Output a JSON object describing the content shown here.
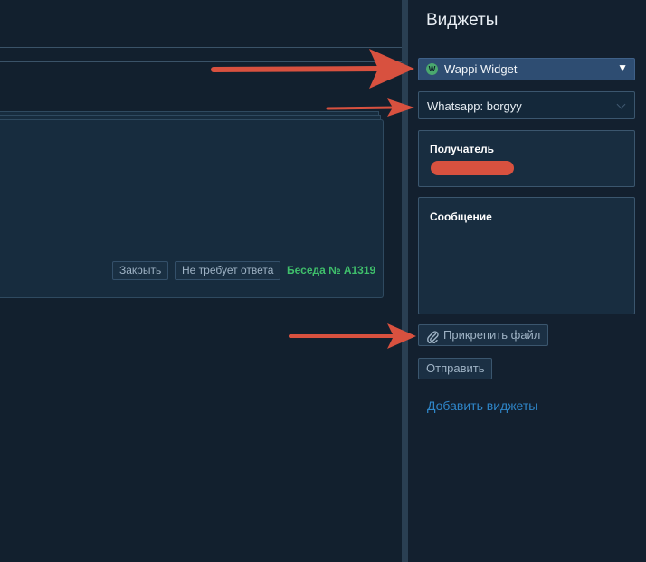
{
  "colors": {
    "background": "#12202e",
    "panel": "#13202f",
    "accent_select": "#2e4d72",
    "conversation_green": "#3fbf6b",
    "link_blue": "#2f86c9",
    "annotation_arrow": "#d8513f"
  },
  "card": {
    "close_label": "Закрыть",
    "no_reply_label": "Не требует ответа",
    "conversation_label": "Беседа № A1319"
  },
  "widgets_panel": {
    "title": "Виджеты",
    "widget_select": {
      "value": "Wappi Widget",
      "logo_letter": "W",
      "caret_icon": "triangle-down-icon"
    },
    "account_select": {
      "value": "Whatsapp: borgyy",
      "caret_icon": "chevron-down-icon"
    },
    "recipient": {
      "label": "Получатель",
      "value_redacted": true
    },
    "message": {
      "label": "Сообщение"
    },
    "attach_button": {
      "label": "Прикрепить файл",
      "icon": "paperclip-icon"
    },
    "send_button": {
      "label": "Отправить"
    },
    "add_widgets_link": "Добавить виджеты"
  }
}
